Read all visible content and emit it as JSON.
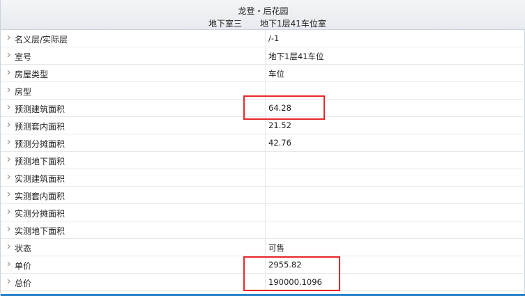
{
  "header": {
    "title": "龙登・后花园",
    "subtitle_left": "地下室三",
    "subtitle_right": "地下1层41车位室"
  },
  "rows": [
    {
      "label": "名义层/实际层",
      "value": "/-1"
    },
    {
      "label": "室号",
      "value": "地下1层41车位"
    },
    {
      "label": "房屋类型",
      "value": "车位"
    },
    {
      "label": "房型",
      "value": ""
    },
    {
      "label": "预测建筑面积",
      "value": "64.28"
    },
    {
      "label": "预测套内面积",
      "value": "21.52"
    },
    {
      "label": "预测分摊面积",
      "value": "42.76"
    },
    {
      "label": "预测地下面积",
      "value": ""
    },
    {
      "label": "实测建筑面积",
      "value": ""
    },
    {
      "label": "实测套内面积",
      "value": ""
    },
    {
      "label": "实测分摊面积",
      "value": ""
    },
    {
      "label": "实测地下面积",
      "value": ""
    },
    {
      "label": "状态",
      "value": "可售"
    },
    {
      "label": "单价",
      "value": "2955.82"
    },
    {
      "label": "总价",
      "value": "190000.1096"
    }
  ],
  "icons": {
    "row_marker": "chevron-right-icon"
  },
  "colors": {
    "highlight": "#e8262a",
    "accent_bar": "#2a82c9"
  }
}
